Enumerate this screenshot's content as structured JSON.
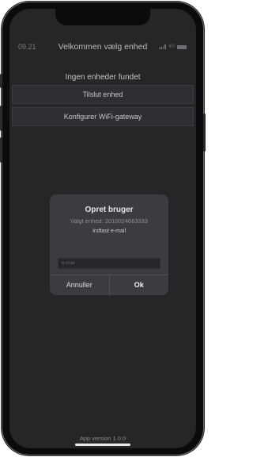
{
  "status_bar": {
    "time": "09.21",
    "network": "4G"
  },
  "header": {
    "title": "Velkommen vælg enhed"
  },
  "main": {
    "no_devices_text": "Ingen enheder fundet",
    "connect_device_label": "Tilslut enhed",
    "configure_gateway_label": "Konfigurer WiFi-gateway"
  },
  "dialog": {
    "title": "Opret bruger",
    "selected_device": "Valgt enhed: 2010024663333",
    "prompt": "Indtast e-mail",
    "email_placeholder": "e-mail",
    "email_value": "",
    "cancel_label": "Annuller",
    "ok_label": "Ok"
  },
  "footer": {
    "app_version": "App version 1.0.0"
  },
  "colors": {
    "screen_background": "#252628",
    "dialog_background": "#3b3c3f",
    "button_background": "#2e2f32"
  }
}
